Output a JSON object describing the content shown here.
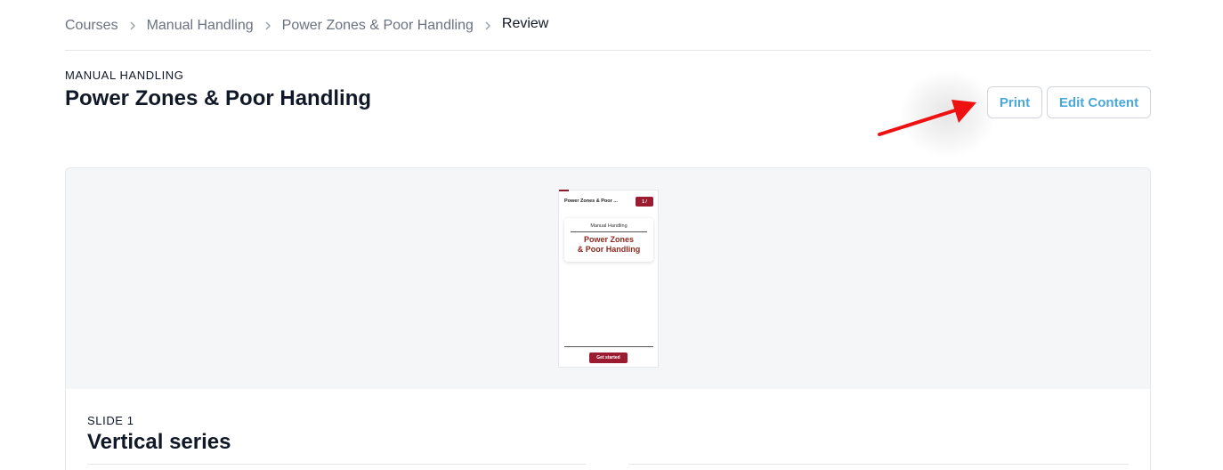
{
  "breadcrumb": {
    "items": [
      "Courses",
      "Manual Handling",
      "Power Zones & Poor Handling"
    ],
    "current": "Review"
  },
  "header": {
    "eyebrow": "MANUAL HANDLING",
    "title": "Power Zones & Poor Handling"
  },
  "actions": {
    "print_label": "Print",
    "edit_label": "Edit Content"
  },
  "preview": {
    "header_title": "Power Zones & Poor ...",
    "badge": "1 /",
    "card_subtitle": "Manual Handling",
    "card_title_line1": "Power Zones",
    "card_title_line2": "& Poor Handling",
    "cta_label": "Get started"
  },
  "slide": {
    "label": "SLIDE 1",
    "title": "Vertical series"
  },
  "colors": {
    "accent_blue": "#4aa8d8",
    "brand_maroon": "#9b1c31",
    "annotation_red": "#ee1111"
  },
  "icons": {
    "breadcrumb_separator": "chevron-right-icon",
    "annotation": "arrow-icon"
  }
}
